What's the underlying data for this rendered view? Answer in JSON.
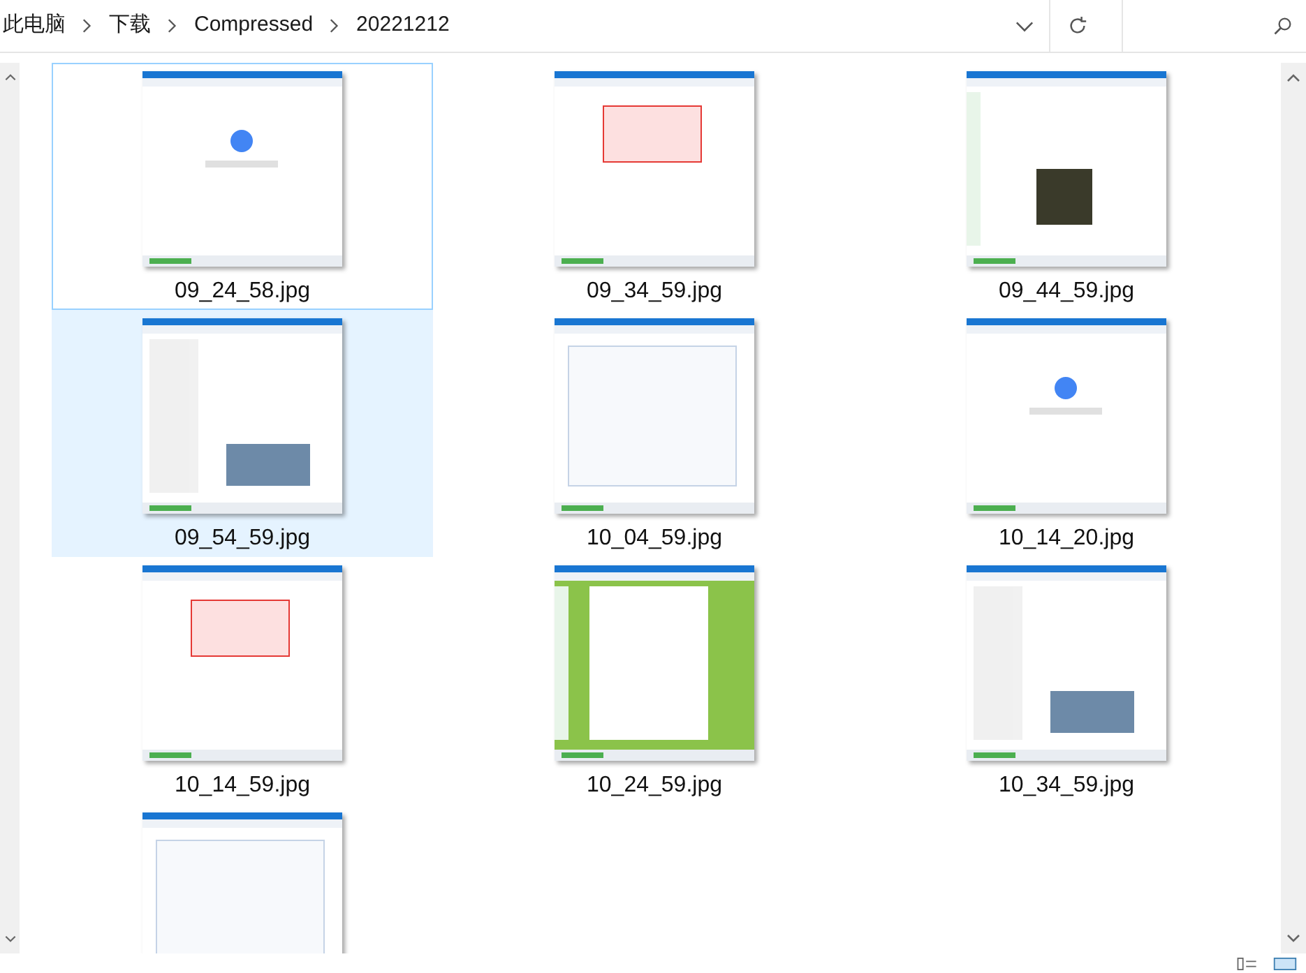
{
  "breadcrumb": [
    "此电脑",
    "下载",
    "Compressed",
    "20221212"
  ],
  "files": [
    {
      "name": "09_24_58.jpg",
      "selected": false,
      "focused": true
    },
    {
      "name": "09_34_59.jpg",
      "selected": false,
      "focused": false
    },
    {
      "name": "09_44_59.jpg",
      "selected": false,
      "focused": false
    },
    {
      "name": "09_54_59.jpg",
      "selected": true,
      "focused": false
    },
    {
      "name": "10_04_59.jpg",
      "selected": false,
      "focused": false
    },
    {
      "name": "10_14_20.jpg",
      "selected": false,
      "focused": false
    },
    {
      "name": "10_14_59.jpg",
      "selected": false,
      "focused": false
    },
    {
      "name": "10_24_59.jpg",
      "selected": false,
      "focused": false
    },
    {
      "name": "10_34_59.jpg",
      "selected": false,
      "focused": false
    },
    {
      "selected": false,
      "focused": false
    }
  ]
}
